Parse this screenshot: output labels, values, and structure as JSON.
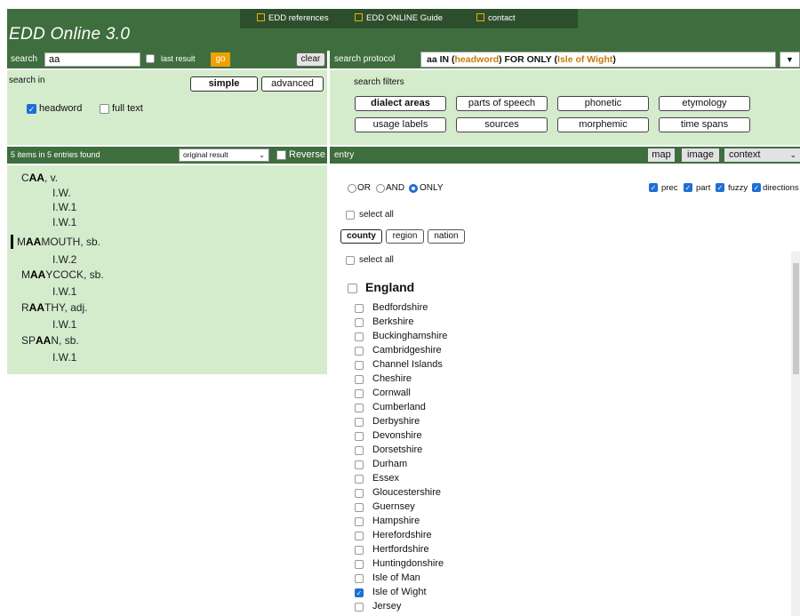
{
  "header": {
    "brand": "EDD Online 3.0",
    "links": [
      "EDD references",
      "EDD ONLINE Guide",
      "contact"
    ],
    "accent_color": "#f0b000",
    "bar_color": "#3f6e3e"
  },
  "search": {
    "label": "search",
    "value": "aa",
    "last_result_label": "last result",
    "last_result_checked": false,
    "go_label": "go",
    "clear_label": "clear"
  },
  "search_in": {
    "label": "search in",
    "simple_label": "simple",
    "advanced_label": "advanced",
    "active_mode": "simple",
    "headword_label": "headword",
    "headword_checked": true,
    "fulltext_label": "full text",
    "fulltext_checked": false
  },
  "results": {
    "count_text": "5 items in 5 entries found",
    "sort_value": "original result",
    "reverse_label": "Reverse",
    "reverse_checked": false,
    "items": [
      {
        "pre": "C",
        "bold": "AA",
        "post": ", v."
      },
      {
        "text": "I.W."
      },
      {
        "text": "I.W.1"
      },
      {
        "text": "I.W.1"
      },
      {
        "pre": "M",
        "bold": "AA",
        "post": "MOUTH, sb."
      },
      {
        "text": "I.W.2"
      },
      {
        "pre": "M",
        "bold": "AA",
        "post": "YCOCK, sb."
      },
      {
        "text": "I.W.1"
      },
      {
        "pre": "R",
        "bold": "AA",
        "post": "THY, adj."
      },
      {
        "text": "I.W.1"
      },
      {
        "pre": "SP",
        "bold": "AA",
        "post": "N, sb."
      },
      {
        "text": "I.W.1"
      }
    ]
  },
  "protocol": {
    "label": "search protocol",
    "query_prefix": "aa IN (",
    "query_field": "headword",
    "query_mid": ") FOR ONLY (",
    "query_value": "Isle of Wight",
    "query_suffix": ")"
  },
  "filters": {
    "label": "search filters",
    "buttons": [
      "dialect areas",
      "parts of speech",
      "phonetic",
      "etymology",
      "usage labels",
      "sources",
      "morphemic",
      "time spans"
    ],
    "active": "dialect areas"
  },
  "entry": {
    "label": "entry",
    "map_label": "map",
    "image_label": "image",
    "context_value": "context",
    "logic": {
      "or": "OR",
      "and": "AND",
      "only": "ONLY",
      "selected": "ONLY"
    },
    "options": {
      "prec": "prec",
      "part": "part",
      "fuzzy": "fuzzy",
      "directions": "directions"
    },
    "select_all_label": "select all",
    "tabs": [
      "county",
      "region",
      "nation"
    ],
    "active_tab": "county",
    "group_label": "England",
    "counties": [
      {
        "name": "Bedfordshire",
        "checked": false
      },
      {
        "name": "Berkshire",
        "checked": false
      },
      {
        "name": "Buckinghamshire",
        "checked": false
      },
      {
        "name": "Cambridgeshire",
        "checked": false
      },
      {
        "name": "Channel Islands",
        "checked": false
      },
      {
        "name": "Cheshire",
        "checked": false
      },
      {
        "name": "Cornwall",
        "checked": false
      },
      {
        "name": "Cumberland",
        "checked": false
      },
      {
        "name": "Derbyshire",
        "checked": false
      },
      {
        "name": "Devonshire",
        "checked": false
      },
      {
        "name": "Dorsetshire",
        "checked": false
      },
      {
        "name": "Durham",
        "checked": false
      },
      {
        "name": "Essex",
        "checked": false
      },
      {
        "name": "Gloucestershire",
        "checked": false
      },
      {
        "name": "Guernsey",
        "checked": false
      },
      {
        "name": "Hampshire",
        "checked": false
      },
      {
        "name": "Herefordshire",
        "checked": false
      },
      {
        "name": "Hertfordshire",
        "checked": false
      },
      {
        "name": "Huntingdonshire",
        "checked": false
      },
      {
        "name": "Isle of Man",
        "checked": false
      },
      {
        "name": "Isle of Wight",
        "checked": true
      },
      {
        "name": "Jersey",
        "checked": false
      }
    ]
  }
}
